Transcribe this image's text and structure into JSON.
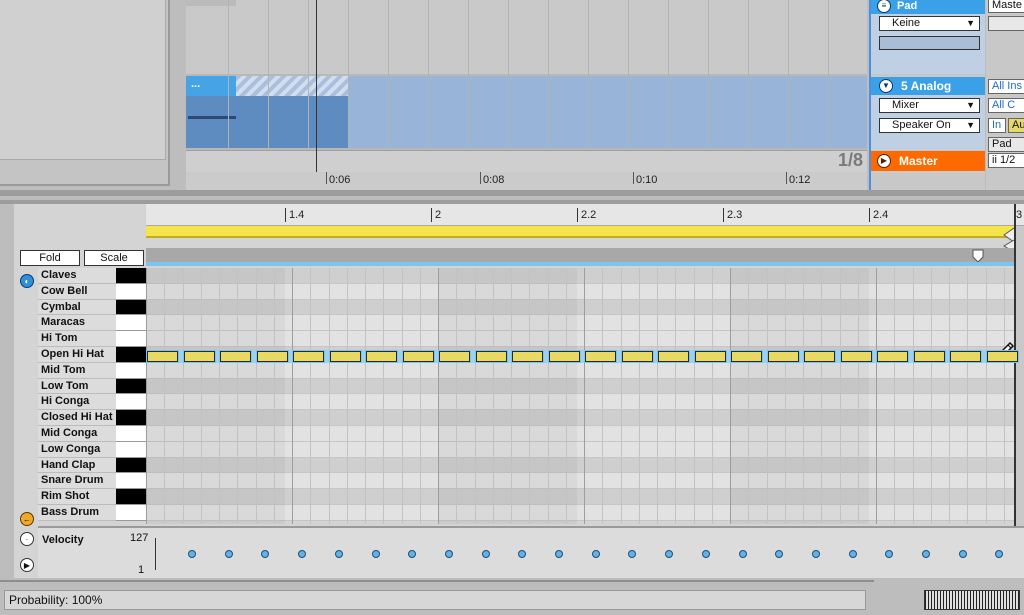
{
  "arrangement": {
    "clip_label": "...",
    "quantization": "1/8",
    "timeline_labels": [
      "0:06",
      "0:08",
      "0:10",
      "0:12"
    ]
  },
  "mixer": {
    "pad_track": {
      "name": "Pad",
      "input": "Keine"
    },
    "analog_track": {
      "name": "5 Analog",
      "routing": "Mixer",
      "output": "Speaker On"
    },
    "master_track": {
      "name": "Master"
    }
  },
  "io": {
    "top": "Maste",
    "input_type": "All Ins",
    "input_channel": "All C",
    "monitor_in": "In",
    "monitor_auto": "Au",
    "output": "Pad",
    "master_out": "ii 1/2"
  },
  "editor": {
    "ruler_labels": [
      "1.4",
      "2",
      "2.2",
      "2.3",
      "2.4",
      "3"
    ],
    "fold_label": "Fold",
    "scale_label": "Scale",
    "drum_names": [
      "Claves",
      "Cow Bell",
      "Cymbal",
      "Maracas",
      "Hi Tom",
      "Open Hi Hat",
      "Mid Tom",
      "Low Tom",
      "Hi Conga",
      "Closed Hi Hat",
      "Mid Conga",
      "Low Conga",
      "Hand Clap",
      "Snare Drum",
      "Rim Shot",
      "Bass Drum"
    ],
    "black_keys": [
      true,
      false,
      true,
      false,
      false,
      true,
      false,
      true,
      false,
      true,
      false,
      false,
      true,
      false,
      true,
      false
    ],
    "note_row": "Open Hi Hat",
    "note_count": 24
  },
  "velocity": {
    "label": "Velocity",
    "max": "127",
    "min": "1",
    "dot_count": 23
  },
  "status": {
    "text": "Probability: 100%"
  }
}
